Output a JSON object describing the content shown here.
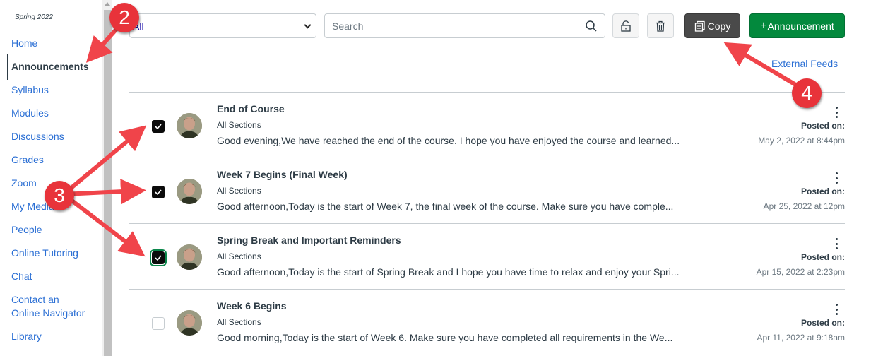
{
  "sidebar": {
    "term": "Spring 2022",
    "items": [
      {
        "label": "Home",
        "active": false
      },
      {
        "label": "Announcements",
        "active": true
      },
      {
        "label": "Syllabus",
        "active": false
      },
      {
        "label": "Modules",
        "active": false
      },
      {
        "label": "Discussions",
        "active": false
      },
      {
        "label": "Grades",
        "active": false
      },
      {
        "label": "Zoom",
        "active": false
      },
      {
        "label": "My Media",
        "active": false
      },
      {
        "label": "People",
        "active": false
      },
      {
        "label": "Online Tutoring",
        "active": false
      },
      {
        "label": "Chat",
        "active": false
      },
      {
        "label": "Contact an Online Navigator",
        "active": false
      },
      {
        "label": "Library",
        "active": false
      }
    ]
  },
  "toolbar": {
    "filter": {
      "value": "All"
    },
    "search": {
      "placeholder": "Search",
      "value": ""
    },
    "unlock_icon": "unlock-icon",
    "delete_icon": "trash-icon",
    "copy_label": "Copy",
    "add_label": "Announcement",
    "external_feeds_label": "External Feeds"
  },
  "announcements": [
    {
      "title": "End of Course",
      "sections": "All Sections",
      "preview": "Good evening,We have reached the end of the course.  I hope you have enjoyed the course and learned...",
      "posted_label": "Posted on:",
      "posted_date": "May 2, 2022 at 8:44pm",
      "checked": true
    },
    {
      "title": "Week 7 Begins (Final Week)",
      "sections": "All Sections",
      "preview": "Good afternoon,Today is the start of Week 7, the final week of the course.  Make sure you have comple...",
      "posted_label": "Posted on:",
      "posted_date": "Apr 25, 2022 at 12pm",
      "checked": true
    },
    {
      "title": "Spring Break and Important Reminders",
      "sections": "All Sections",
      "preview": "Good afternoon,Today is the start of Spring Break and I hope you have time to relax and enjoy your Spri...",
      "posted_label": "Posted on:",
      "posted_date": "Apr 15, 2022 at 2:23pm",
      "checked": true
    },
    {
      "title": "Week 6 Begins",
      "sections": "All Sections",
      "preview": "Good morning,Today is the start of Week 6.  Make sure you have completed all requirements in the We...",
      "posted_label": "Posted on:",
      "posted_date": "Apr 11, 2022 at 9:18am",
      "checked": false
    }
  ],
  "annotations": {
    "step2": "2",
    "step3": "3",
    "step4": "4",
    "color": "#e8333a"
  },
  "colors": {
    "link": "#2b6fd4",
    "primary_green": "#03893d",
    "copy_dark": "#4a4a4a",
    "text": "#2d3b45"
  }
}
